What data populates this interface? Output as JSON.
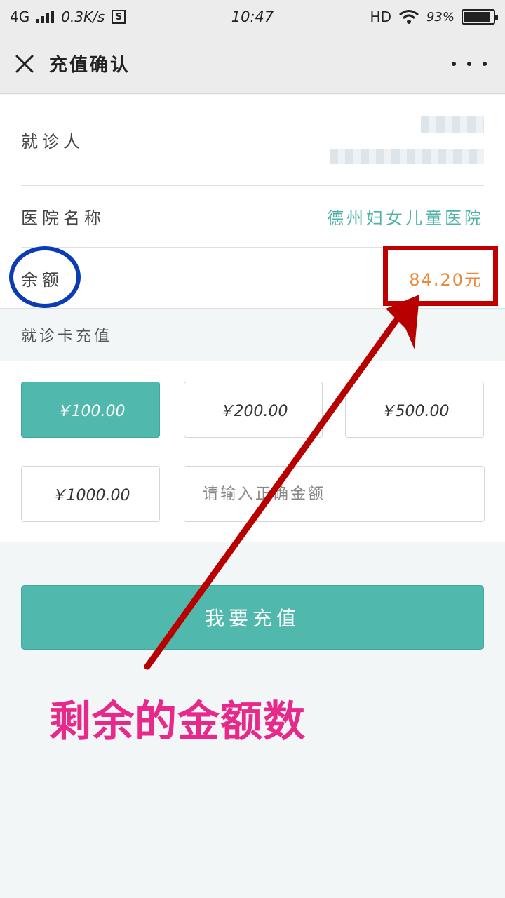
{
  "status_bar": {
    "network": "4G",
    "speed": "0.3K/s",
    "s_badge": "S",
    "time": "10:47",
    "hd": "HD",
    "battery_percent": "93%",
    "battery_level": 0.93
  },
  "nav": {
    "title": "充值确认",
    "close_icon": "close-icon",
    "more_icon": "more-dots-icon"
  },
  "info": {
    "patient_label": "就诊人",
    "hospital_label": "医院名称",
    "hospital_name": "德州妇女儿童医院",
    "balance_label": "余额",
    "balance_value": "84.20元"
  },
  "recharge": {
    "section_title": "就诊卡充值",
    "amounts": [
      "￥100.00",
      "￥200.00",
      "￥500.00",
      "￥1000.00"
    ],
    "selected_index": 0,
    "custom_placeholder": "请输入正确金额",
    "submit_label": "我要充值"
  },
  "annotation": {
    "text": "剩余的金额数",
    "circle_color": "#0c3cb4",
    "box_color": "#c00000",
    "arrow_color": "#b80000",
    "text_color": "#e8298c"
  },
  "colors": {
    "accent": "#50b8ad",
    "hospital_text": "#4db3a6",
    "balance_text": "#e8893c"
  }
}
